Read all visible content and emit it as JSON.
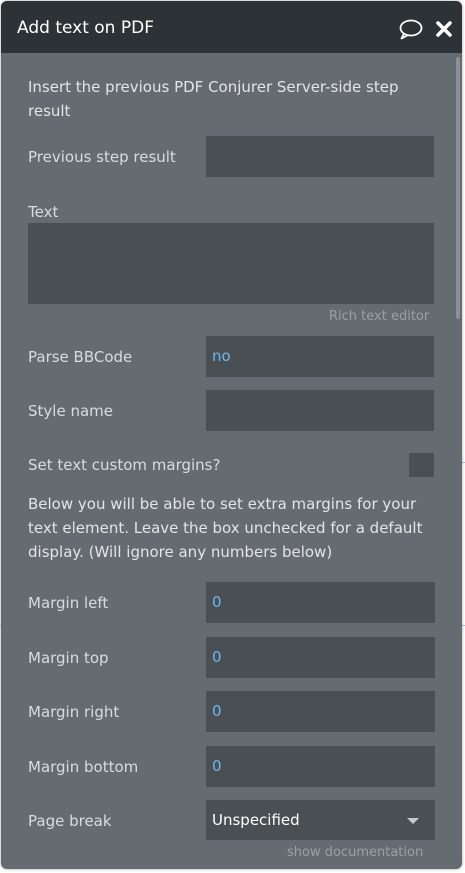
{
  "panel": {
    "title": "Add text on PDF",
    "icons": [
      "comment-icon",
      "close-icon"
    ]
  },
  "intro": "Insert the previous PDF Conjurer Server-side step result",
  "fields": {
    "previous_step_result": {
      "label": "Previous step result",
      "value": ""
    },
    "text": {
      "label": "Text",
      "value": ""
    },
    "rich_text_link": "Rich text editor",
    "parse_bbcode": {
      "label": "Parse BBCode",
      "value": "no"
    },
    "style_name": {
      "label": "Style name",
      "value": ""
    },
    "custom_margins": {
      "label": "Set text custom margins?",
      "checked": false
    },
    "margins_help": "Below you will be able to set extra margins for your text element. Leave the box unchecked for a default display. (Will ignore any numbers below)",
    "margin_left": {
      "label": "Margin left",
      "value": "0"
    },
    "margin_top": {
      "label": "Margin top",
      "value": "0"
    },
    "margin_right": {
      "label": "Margin right",
      "value": "0"
    },
    "margin_bottom": {
      "label": "Margin bottom",
      "value": "0"
    },
    "page_break": {
      "label": "Page break",
      "value": "Unspecified"
    }
  },
  "footer": {
    "documentation_link": "show documentation"
  },
  "colors": {
    "panel_bg": "#656b70",
    "header_bg": "#2d3236",
    "field_bg": "#4a4f53",
    "value_blue": "#6fb6f0"
  }
}
